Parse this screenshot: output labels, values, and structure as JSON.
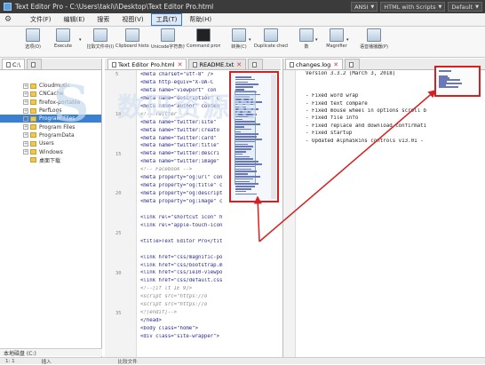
{
  "window": {
    "title": "Text Editor Pro - C:\\Users\\taki\\i\\Desktop\\Text Editor Pro.html",
    "encoding": "ANSI",
    "highlighter": "HTML with Scripts",
    "scheme": "Default"
  },
  "menu": {
    "items": [
      "文件(F)",
      "编辑(E)",
      "搜索",
      "视图(V)",
      "工具(T)",
      "帮助(H)"
    ],
    "active_index": 4
  },
  "toolbar": {
    "buttons": [
      "选项(O)",
      "Execute",
      "拉取文件中(I)",
      "Clipboard history",
      "Unicode字符表(U)",
      "Command prompt",
      "转换(C)",
      "Duplicate checker",
      "数",
      "Magnifier",
      "语音播播器(P)"
    ]
  },
  "left_pane": {
    "tab": "C:\\",
    "tree": [
      {
        "label": "Cloudmusic",
        "expandable": true
      },
      {
        "label": "CNCache",
        "expandable": true
      },
      {
        "label": "firefox-portable",
        "expandable": true
      },
      {
        "label": "PerfLogs",
        "expandable": true
      },
      {
        "label": "Program Files",
        "expandable": true,
        "selected": true
      },
      {
        "label": "Program Files",
        "expandable": true
      },
      {
        "label": "ProgramData",
        "expandable": true
      },
      {
        "label": "Users",
        "expandable": true
      },
      {
        "label": "Windows",
        "expandable": true
      },
      {
        "label": "桌面下载",
        "expandable": false
      }
    ],
    "drive_label": "本地磁盘 (C:)"
  },
  "editor_left": {
    "tabs": [
      {
        "label": "Text Editor Pro.html",
        "active": true
      },
      {
        "label": "README.txt",
        "active": false
      }
    ],
    "line_numbers": [
      {
        "n": "5",
        "row": 0
      },
      {
        "n": "10",
        "row": 5
      },
      {
        "n": "15",
        "row": 10
      },
      {
        "n": "20",
        "row": 15
      },
      {
        "n": "25",
        "row": 20
      },
      {
        "n": "30",
        "row": 25
      },
      {
        "n": "35",
        "row": 30
      }
    ],
    "lines": [
      {
        "t": "  <meta charset=\"utf-8\" />",
        "c": false
      },
      {
        "t": "  <meta http-equiv=\"X-UA-C",
        "c": false
      },
      {
        "t": "  <meta name=\"viewport\" con",
        "c": false
      },
      {
        "t": "  <meta name=\"description\" c",
        "c": false
      },
      {
        "t": "  <meta name=\"author\" conten",
        "c": false
      },
      {
        "t": "  <!-- Twitter -->",
        "c": true
      },
      {
        "t": "  <meta name=\"twitter:site\"",
        "c": false
      },
      {
        "t": "  <meta name=\"twitter:creato",
        "c": false
      },
      {
        "t": "  <meta name=\"twitter:card\"",
        "c": false
      },
      {
        "t": "  <meta name=\"twitter:title\"",
        "c": false
      },
      {
        "t": "  <meta name=\"twitter:descri",
        "c": false
      },
      {
        "t": "  <meta name=\"twitter:image\"",
        "c": false
      },
      {
        "t": "  <!-- Facebook -->",
        "c": true
      },
      {
        "t": "  <meta property=\"og:url\" con",
        "c": false
      },
      {
        "t": "  <meta property=\"og:title\" c",
        "c": false
      },
      {
        "t": "  <meta property=\"og:descript",
        "c": false
      },
      {
        "t": "  <meta property=\"og:image\" c",
        "c": false
      },
      {
        "t": "",
        "c": false
      },
      {
        "t": "  <link rel=\"shortcut icon\" h",
        "c": false
      },
      {
        "t": "  <link rel=\"apple-touch-icon",
        "c": false
      },
      {
        "t": "",
        "c": false
      },
      {
        "t": "  <title>Text Editor Pro</tit",
        "c": false
      },
      {
        "t": "",
        "c": false
      },
      {
        "t": "  <link href=\"css/magnific-po",
        "c": false
      },
      {
        "t": "  <link href=\"css/bootstrap.m",
        "c": false
      },
      {
        "t": "  <link href=\"css/ie10-viewpo",
        "c": false
      },
      {
        "t": "  <link href=\"css/default.css",
        "c": false
      },
      {
        "t": "  <!--[if lt IE 9]>",
        "c": true
      },
      {
        "t": "     <script src=\"https://o",
        "c": true
      },
      {
        "t": "     <script src=\"https://o",
        "c": true
      },
      {
        "t": "  <![endif]-->",
        "c": true
      },
      {
        "t": "</head>",
        "c": false
      },
      {
        "t": "<body class=\"home\">",
        "c": false
      },
      {
        "t": "<div class=\"site-wrapper\">",
        "c": false
      }
    ]
  },
  "editor_right": {
    "tab": "changes.log",
    "lines": [
      "  Version 3.3.2 (March 3, 2018)",
      "",
      "",
      "  - Fixed word wrap",
      "  - Fixed text compare",
      "  - Fixed mouse wheel in options scroll b",
      "  - Fixed file info",
      "  - Fixed replace and download confirmati",
      "  - Fixed startup",
      "  - Updated AlphaSkins controls v13.01 -"
    ]
  },
  "statusbar": {
    "position": "1: 1",
    "mode": "插入",
    "info": "比较文件"
  },
  "watermark": {
    "logo_glyph": "S",
    "text": "数码资源网"
  },
  "colors": {
    "highlight_box": "#d62020",
    "selection": "#3a7fd0",
    "titlebar": "#3b3b3b"
  }
}
